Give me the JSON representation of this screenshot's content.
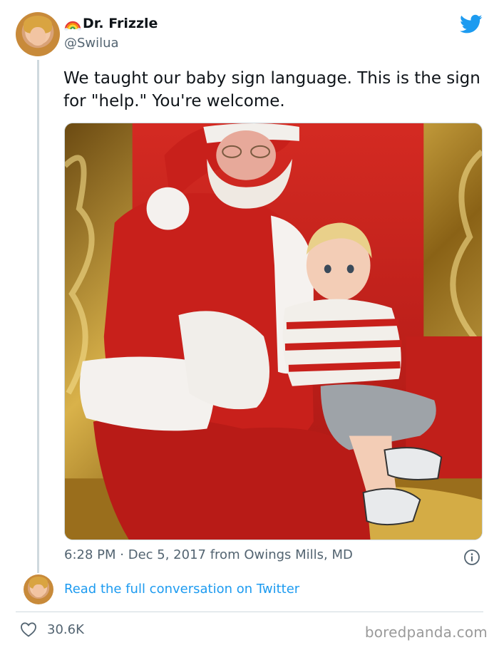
{
  "tweet": {
    "display_name": "Dr. Frizzle",
    "handle": "@Swilua",
    "text": "We taught our baby sign language. This is the sign for \"help.\" You're welcome.",
    "time": "6:28 PM",
    "separator": "·",
    "date_location": "Dec 5, 2017 from Owings Mills, MD",
    "read_more": "Read the full conversation on Twitter",
    "likes": "30.6K"
  },
  "watermark": "boredpanda.com",
  "icons": {
    "rainbow": "rainbow-emoji-icon",
    "brand": "twitter-bird-icon",
    "info": "info-icon",
    "like": "heart-icon"
  },
  "colors": {
    "brand_blue": "#1d9bf0",
    "link_blue": "#1d9bf0",
    "secondary_text": "#536471",
    "primary_text": "#0f1419",
    "border": "#cfd9de"
  }
}
